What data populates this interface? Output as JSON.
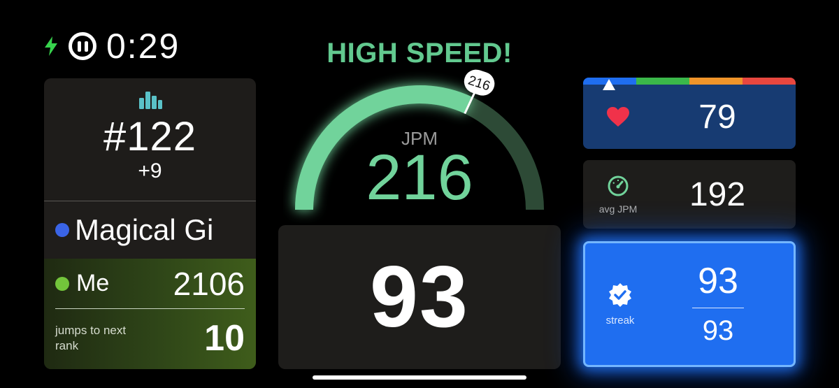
{
  "status": {
    "timer": "0:29",
    "bolt_color": "#37d34d"
  },
  "rank": {
    "position": "#122",
    "delta": "+9",
    "icon_color": "#5ac2c8",
    "rival": {
      "name": "Magical Gi",
      "dot_color": "#3a64e6"
    },
    "me": {
      "label": "Me",
      "score": "2106",
      "dot_color": "#73c53b"
    },
    "next_rank": {
      "label": "jumps to next rank",
      "value": "10"
    }
  },
  "speed": {
    "headline": "HIGH SPEED!",
    "unit": "JPM",
    "value": "216",
    "pin_value": "216",
    "gauge_fraction": 0.64,
    "accent": "#71d39b"
  },
  "jump_count": {
    "value": "93"
  },
  "heart_rate": {
    "value": "79",
    "zone_colors": [
      "#1f6ef0",
      "#3bb84a",
      "#f0952a",
      "#e8473f"
    ],
    "heart_color": "#f0324a"
  },
  "avg_jpm": {
    "label": "avg JPM",
    "value": "192"
  },
  "streak": {
    "label": "streak",
    "current": "93",
    "best": "93"
  }
}
